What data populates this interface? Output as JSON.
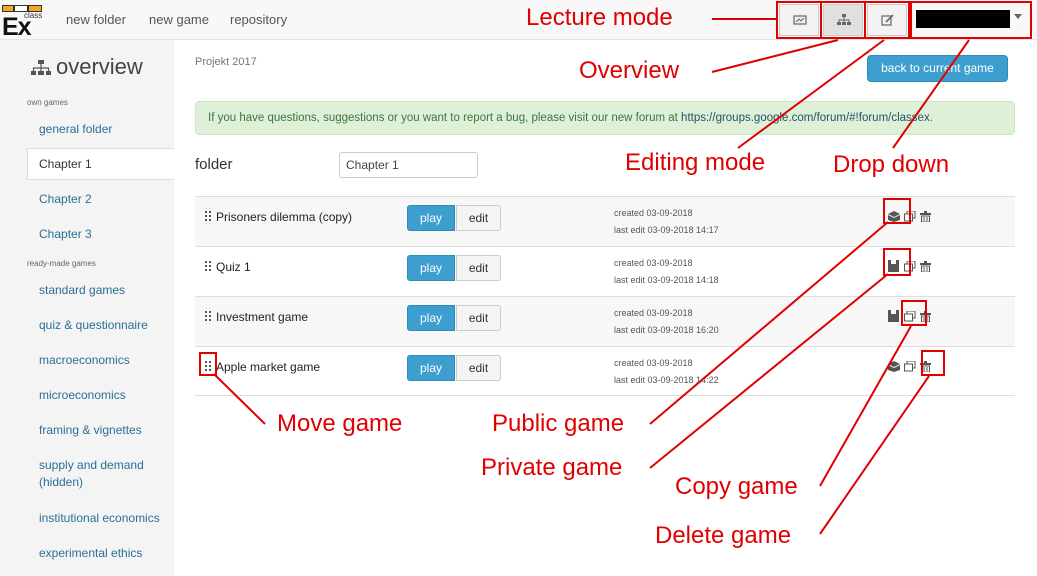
{
  "nav": {
    "logo_small": "class",
    "logo_big": "Ex",
    "links": [
      "new folder",
      "new game",
      "repository"
    ]
  },
  "sidebar": {
    "title": "overview",
    "own_games_heading": "own games",
    "own_items": [
      "general folder",
      "Chapter 1",
      "Chapter 2",
      "Chapter 3"
    ],
    "active_item": "Chapter 1",
    "readymade_heading": "ready-made games",
    "ready_items": [
      "standard games",
      "quiz & questionnaire",
      "macroeconomics",
      "microeconomics",
      "framing & vignettes",
      "supply and demand (hidden)",
      "institutional economics",
      "experimental ethics"
    ]
  },
  "main": {
    "project": "Projekt 2017",
    "back_button": "back to current game",
    "alert_text": "If you have questions, suggestions or you want to report a bug, please visit our new forum at ",
    "alert_link": "https://groups.google.com/forum/#!forum/classex",
    "alert_end": ".",
    "folder_label": "folder",
    "folder_value": "Chapter 1",
    "play_label": "play",
    "edit_label": "edit",
    "games": [
      {
        "name": "Prisoners dilemma (copy)",
        "created": "created 03-09-2018",
        "edited": "last edit 03-09-2018 14:17",
        "visibility": "public"
      },
      {
        "name": "Quiz 1",
        "created": "created 03-09-2018",
        "edited": "last edit 03-09-2018 14:18",
        "visibility": "private"
      },
      {
        "name": "Investment game",
        "created": "created 03-09-2018",
        "edited": "last edit 03-09-2018 16:20",
        "visibility": "private"
      },
      {
        "name": "Apple market game",
        "created": "created 03-09-2018",
        "edited": "last edit 03-09-2018 14:22",
        "visibility": "public"
      }
    ]
  },
  "annotations": {
    "lecture_mode": "Lecture mode",
    "overview": "Overview",
    "editing_mode": "Editing mode",
    "drop_down": "Drop down",
    "move_game": "Move game",
    "public_game": "Public game",
    "private_game": "Private game",
    "copy_game": "Copy game",
    "delete_game": "Delete game",
    "color": "#e00000"
  }
}
